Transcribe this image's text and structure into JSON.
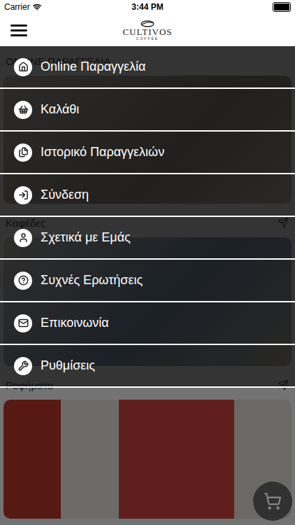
{
  "status_bar": {
    "carrier": "Carrier",
    "time": "3:44 PM",
    "battery": {
      "level": 1
    }
  },
  "header": {
    "logo": {
      "name": "CULTIVOS",
      "tagline": "COFFEE"
    }
  },
  "sections": [
    {
      "title": "ONLINE ΠΑΡΑΓΓΕΛΙΑ",
      "has_arrow": false
    },
    {
      "title": "Καφέδες",
      "has_arrow": true
    },
    {
      "title": "Ροφήματα",
      "has_arrow": true
    }
  ],
  "menu": {
    "open": true,
    "items": [
      {
        "label": "Online Παραγγελία"
      },
      {
        "label": "Καλάθι"
      },
      {
        "label": "Ιστορικό Παραγγελιών"
      },
      {
        "label": "Σύνδεση"
      },
      {
        "label": "Σχετικά με Εμάς"
      },
      {
        "label": "Συχνές Ερωτήσεις"
      },
      {
        "label": "Επικοινωνία"
      },
      {
        "label": "Ρυθμίσεις"
      }
    ]
  }
}
